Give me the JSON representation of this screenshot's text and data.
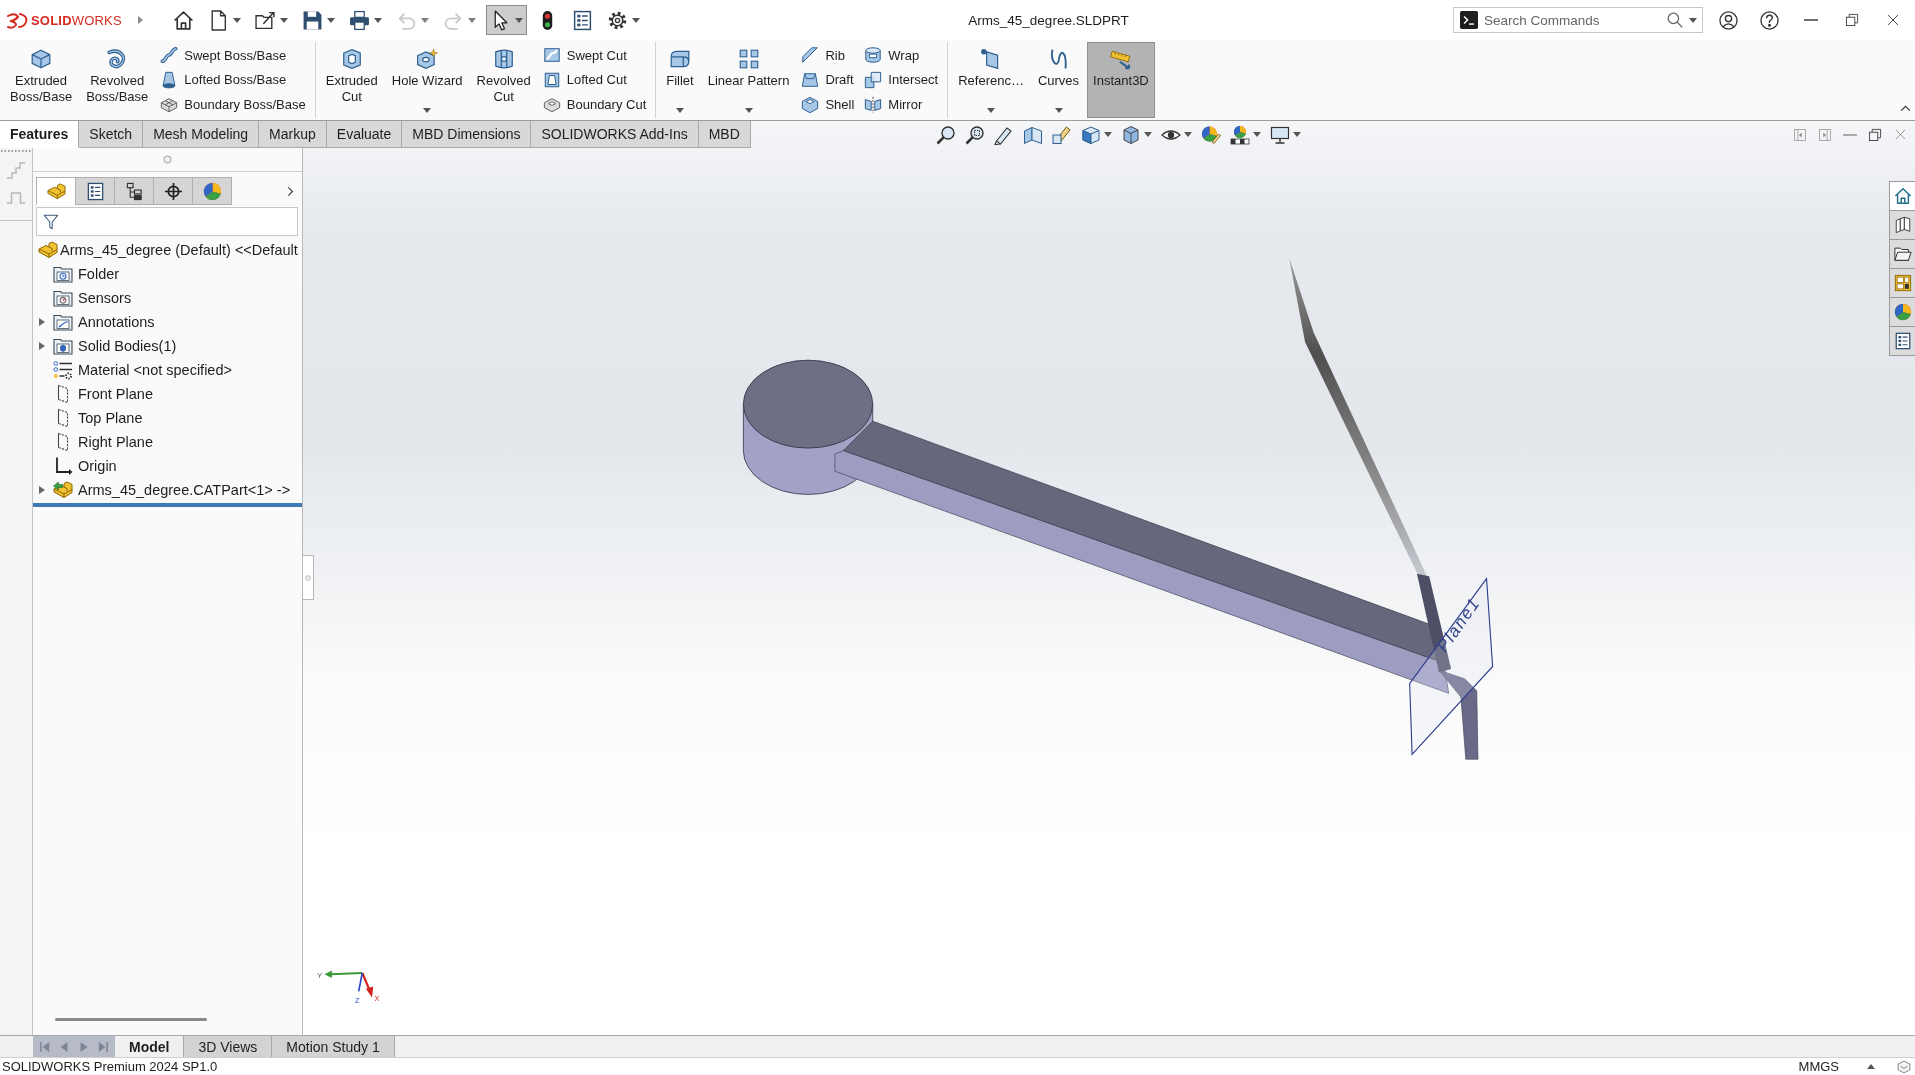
{
  "title_bar": {
    "logo": "**SOLID**WORKS",
    "quick_access": [
      {
        "kind": "home",
        "dropdown": false,
        "disabled": false,
        "pressed": false
      },
      {
        "kind": "new",
        "dropdown": true,
        "disabled": false,
        "pressed": false
      },
      {
        "kind": "open",
        "dropdown": true,
        "disabled": false,
        "pressed": false
      },
      {
        "kind": "save",
        "dropdown": true,
        "disabled": false,
        "pressed": false
      },
      {
        "kind": "print",
        "dropdown": true,
        "disabled": false,
        "pressed": false
      },
      {
        "kind": "undo",
        "dropdown": true,
        "disabled": true,
        "pressed": false
      },
      {
        "kind": "redo",
        "dropdown": true,
        "disabled": true,
        "pressed": false
      },
      {
        "kind": "select",
        "dropdown": true,
        "disabled": false,
        "pressed": true
      },
      {
        "kind": "rebuild",
        "dropdown": false,
        "disabled": false,
        "pressed": false
      },
      {
        "kind": "properties",
        "dropdown": false,
        "disabled": false,
        "pressed": false
      },
      {
        "kind": "options",
        "dropdown": true,
        "disabled": false,
        "pressed": false
      }
    ],
    "document_title": "Arms_45_degree.SLDPRT",
    "search": {
      "placeholder": "Search Commands"
    }
  },
  "ribbon": {
    "groups": [
      {
        "columns": [
          {
            "kind": "large",
            "button": {
              "kind": "extrude",
              "label": "Extruded Boss/Base",
              "dropdown": false,
              "pressed": false
            }
          },
          {
            "kind": "large",
            "button": {
              "kind": "revolve",
              "label": "Revolved Boss/Base",
              "dropdown": false,
              "pressed": false
            }
          },
          {
            "kind": "stack",
            "buttons": [
              {
                "kind": "swept",
                "label": "Swept Boss/Base"
              },
              {
                "kind": "lofted",
                "label": "Lofted Boss/Base"
              },
              {
                "kind": "boundary",
                "label": "Boundary Boss/Base"
              }
            ]
          }
        ]
      },
      {
        "columns": [
          {
            "kind": "large",
            "button": {
              "kind": "extrude-cut",
              "label": "Extruded Cut",
              "dropdown": false,
              "pressed": false
            }
          },
          {
            "kind": "large",
            "button": {
              "kind": "hole-wizard",
              "label": "Hole Wizard",
              "dropdown": true,
              "pressed": false
            }
          },
          {
            "kind": "large",
            "button": {
              "kind": "revolve-cut",
              "label": "Revolved Cut",
              "dropdown": false,
              "pressed": false
            }
          },
          {
            "kind": "stack",
            "buttons": [
              {
                "kind": "swept-cut",
                "label": "Swept Cut"
              },
              {
                "kind": "lofted-cut",
                "label": "Lofted Cut"
              },
              {
                "kind": "boundary-cut",
                "label": "Boundary Cut"
              }
            ]
          }
        ]
      },
      {
        "columns": [
          {
            "kind": "large",
            "button": {
              "kind": "fillet",
              "label": "Fillet",
              "dropdown": true,
              "pressed": false
            }
          },
          {
            "kind": "large",
            "button": {
              "kind": "linear-pattern",
              "label": "Linear Pattern",
              "dropdown": true,
              "pressed": false
            }
          },
          {
            "kind": "stack",
            "buttons": [
              {
                "kind": "rib",
                "label": "Rib"
              },
              {
                "kind": "draft",
                "label": "Draft"
              },
              {
                "kind": "shell",
                "label": "Shell"
              }
            ]
          },
          {
            "kind": "stack",
            "buttons": [
              {
                "kind": "wrap",
                "label": "Wrap"
              },
              {
                "kind": "intersect",
                "label": "Intersect"
              },
              {
                "kind": "mirror",
                "label": "Mirror"
              }
            ]
          }
        ]
      },
      {
        "columns": [
          {
            "kind": "large",
            "button": {
              "kind": "reference",
              "label": "Referenc…",
              "dropdown": true,
              "pressed": false
            }
          },
          {
            "kind": "large",
            "button": {
              "kind": "curves",
              "label": "Curves",
              "dropdown": true,
              "pressed": false
            }
          },
          {
            "kind": "large",
            "button": {
              "kind": "instant3d",
              "label": "Instant3D",
              "dropdown": false,
              "pressed": true
            }
          }
        ]
      }
    ]
  },
  "command_tabs": [
    {
      "label": "Features",
      "selected": true
    },
    {
      "label": "Sketch",
      "selected": false
    },
    {
      "label": "Mesh Modeling",
      "selected": false
    },
    {
      "label": "Markup",
      "selected": false
    },
    {
      "label": "Evaluate",
      "selected": false
    },
    {
      "label": "MBD Dimensions",
      "selected": false
    },
    {
      "label": "SOLIDWORKS Add-Ins",
      "selected": false
    },
    {
      "label": "MBD",
      "selected": false
    }
  ],
  "view_toolbar": [
    {
      "kind": "zoom-fit",
      "dropdown": false
    },
    {
      "kind": "zoom-area",
      "dropdown": false
    },
    {
      "kind": "previous-view",
      "dropdown": false
    },
    {
      "kind": "section-view",
      "dropdown": false
    },
    {
      "kind": "annotation-views",
      "dropdown": false
    },
    {
      "kind": "view-orientation",
      "dropdown": true
    },
    {
      "kind": "display-style",
      "dropdown": true
    },
    {
      "kind": "hide-show",
      "dropdown": true
    },
    {
      "kind": "edit-appearance",
      "dropdown": false
    },
    {
      "kind": "apply-scene",
      "dropdown": true
    },
    {
      "kind": "view-settings",
      "dropdown": true
    }
  ],
  "feature_tree": {
    "panel_tabs": [
      {
        "kind": "feature-manager",
        "selected": true
      },
      {
        "kind": "property-manager",
        "selected": false
      },
      {
        "kind": "configuration-manager",
        "selected": false
      },
      {
        "kind": "dimxpert-manager",
        "selected": false
      },
      {
        "kind": "display-manager",
        "selected": false
      }
    ],
    "root": {
      "label": "Arms_45_degree (Default) <<Default",
      "kind": "part",
      "children": [
        {
          "label": "Folder",
          "kind": "folder"
        },
        {
          "label": "Sensors",
          "kind": "sensors"
        },
        {
          "label": "Annotations",
          "kind": "annotations",
          "expanded": false
        },
        {
          "label": "Solid Bodies(1)",
          "kind": "solid-bodies",
          "expanded": false
        },
        {
          "label": "Material <not specified>",
          "kind": "material"
        },
        {
          "label": "Front Plane",
          "kind": "plane"
        },
        {
          "label": "Top Plane",
          "kind": "plane"
        },
        {
          "label": "Right Plane",
          "kind": "plane"
        },
        {
          "label": "Origin",
          "kind": "origin"
        },
        {
          "label": "Arms_45_degree.CATPart<1> ->",
          "kind": "imported-part",
          "expanded": false
        }
      ]
    }
  },
  "task_pane": [
    {
      "kind": "home",
      "selected": true
    },
    {
      "kind": "design-library",
      "selected": false
    },
    {
      "kind": "file-explorer",
      "selected": false
    },
    {
      "kind": "view-palette",
      "selected": false
    },
    {
      "kind": "appearances",
      "selected": false
    },
    {
      "kind": "custom-properties",
      "selected": false
    }
  ],
  "viewport": {
    "plane_label": "Plane1",
    "triad_labels": [
      "Y",
      "Z",
      "X"
    ]
  },
  "model_tabs": [
    {
      "label": "Model",
      "selected": true
    },
    {
      "label": "3D Views",
      "selected": false
    },
    {
      "label": "Motion Study 1",
      "selected": false
    }
  ],
  "status_bar": {
    "product": "SOLIDWORKS Premium 2024 SP1.0",
    "units": "MMGS"
  }
}
